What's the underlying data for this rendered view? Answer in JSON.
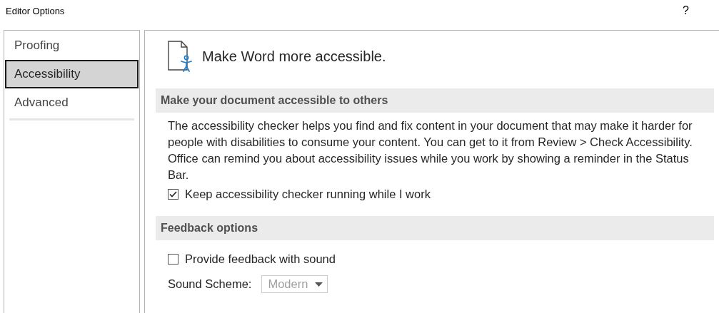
{
  "window": {
    "title": "Editor Options",
    "help": "?"
  },
  "sidebar": {
    "items": [
      {
        "label": "Proofing",
        "selected": false
      },
      {
        "label": "Accessibility",
        "selected": true
      },
      {
        "label": "Advanced",
        "selected": false
      }
    ]
  },
  "header": {
    "title": "Make Word more accessible."
  },
  "sections": [
    {
      "title": "Make your document accessible to others",
      "items": [
        {
          "kind": "paragraph",
          "text": "The accessibility checker helps you find and fix content in your document that may make it harder for people with disabilities to consume your content. You can get to it from Review > Check Accessibility. Office can remind you about accessibility issues while you work by showing a reminder in the Status Bar."
        },
        {
          "kind": "checkbox",
          "label": "Keep accessibility checker running while I work",
          "checked": true
        }
      ]
    },
    {
      "title": "Feedback options",
      "items": [
        {
          "kind": "checkbox",
          "label": "Provide feedback with sound",
          "checked": false
        },
        {
          "kind": "dropdown",
          "label": "Sound Scheme:",
          "value": "Modern",
          "disabled": true
        }
      ]
    }
  ]
}
